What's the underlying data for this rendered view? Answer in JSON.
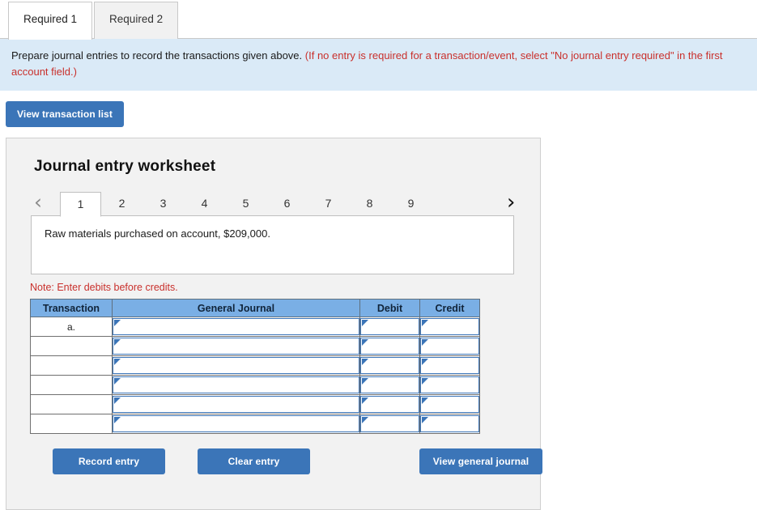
{
  "tabs": [
    {
      "label": "Required 1",
      "active": true
    },
    {
      "label": "Required 2",
      "active": false
    }
  ],
  "instruction": {
    "main": "Prepare journal entries to record the transactions given above.",
    "note": "(If no entry is required for a transaction/event, select \"No journal entry required\" in the first account field.)"
  },
  "toolbar": {
    "view_transaction_list": "View transaction list"
  },
  "worksheet": {
    "title": "Journal entry worksheet",
    "pager": {
      "prev_icon": "‹",
      "next_icon": "›",
      "pages": [
        "1",
        "2",
        "3",
        "4",
        "5",
        "6",
        "7",
        "8",
        "9"
      ],
      "active_page": "1"
    },
    "transaction_text": "Raw materials purchased on account, $209,000.",
    "table_note": "Note: Enter debits before credits.",
    "table": {
      "headers": [
        "Transaction",
        "General Journal",
        "Debit",
        "Credit"
      ],
      "rows": [
        {
          "transaction": "a.",
          "general_journal": "",
          "debit": "",
          "credit": ""
        },
        {
          "transaction": "",
          "general_journal": "",
          "debit": "",
          "credit": ""
        },
        {
          "transaction": "",
          "general_journal": "",
          "debit": "",
          "credit": ""
        },
        {
          "transaction": "",
          "general_journal": "",
          "debit": "",
          "credit": ""
        },
        {
          "transaction": "",
          "general_journal": "",
          "debit": "",
          "credit": ""
        },
        {
          "transaction": "",
          "general_journal": "",
          "debit": "",
          "credit": ""
        }
      ]
    },
    "actions": {
      "record_entry": "Record entry",
      "clear_entry": "Clear entry",
      "view_general_journal": "View general journal"
    }
  },
  "colors": {
    "banner_bg": "#daeaf7",
    "button_blue": "#3b75b8",
    "table_header_blue": "#7aafe5",
    "note_red": "#c9302c",
    "panel_bg": "#f2f2f2"
  }
}
